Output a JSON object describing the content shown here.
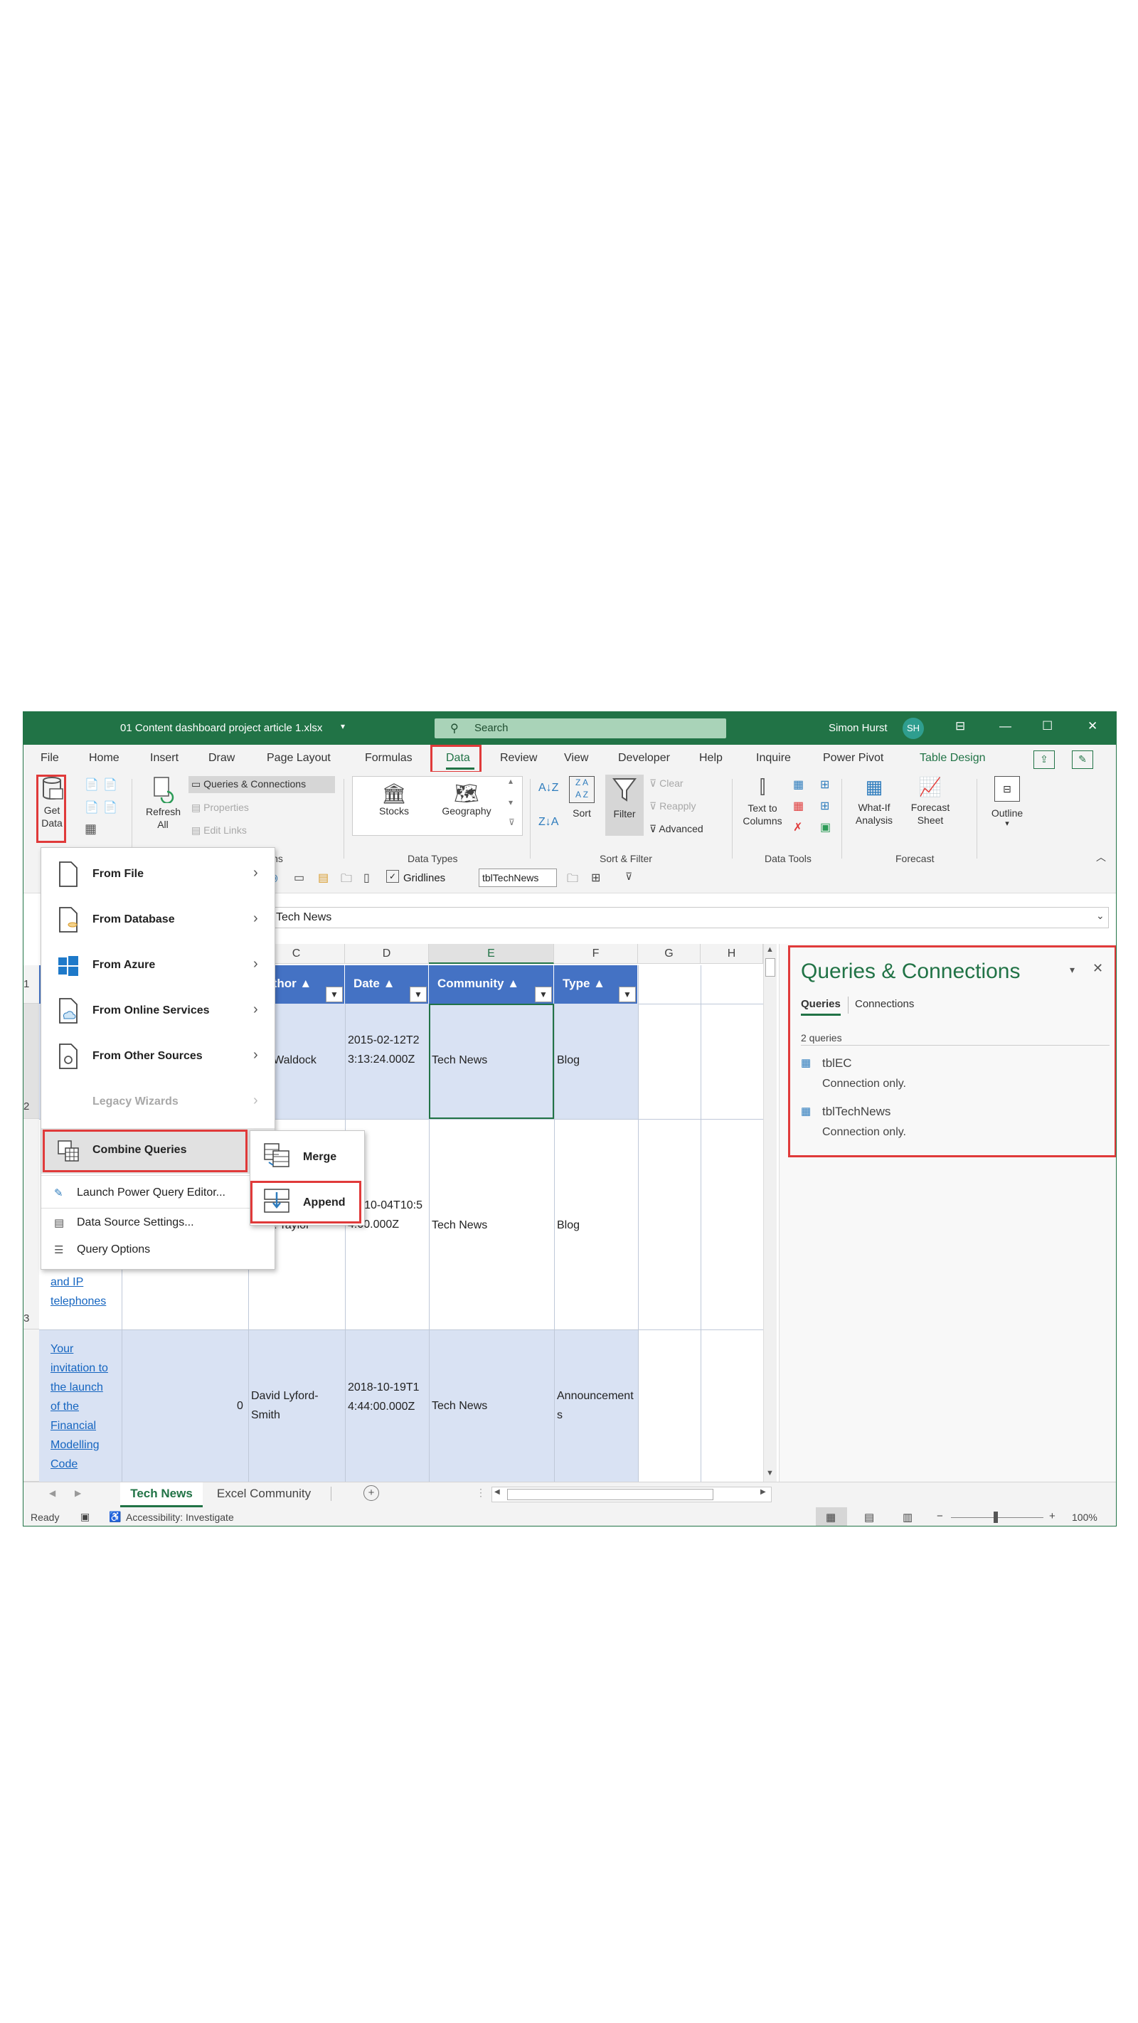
{
  "title_bar": {
    "file_name": "01 Content dashboard project article 1.xlsx",
    "search_placeholder": "Search",
    "user_name": "Simon Hurst",
    "user_initials": "SH"
  },
  "menu_tabs": [
    "File",
    "Home",
    "Insert",
    "Draw",
    "Page Layout",
    "Formulas",
    "Data",
    "Review",
    "View",
    "Developer",
    "Help",
    "Inquire",
    "Power Pivot",
    "Table Design"
  ],
  "ribbon": {
    "get_data": "Get Data",
    "refresh_all": "Refresh All",
    "queries_connections": "Queries & Connections",
    "properties": "Properties",
    "edit_links": "Edit Links",
    "stocks": "Stocks",
    "geography": "Geography",
    "sort": "Sort",
    "filter": "Filter",
    "clear": "Clear",
    "reapply": "Reapply",
    "advanced": "Advanced",
    "text_to_columns": "Text to Columns",
    "what_if": "What-If Analysis",
    "forecast_sheet": "Forecast Sheet",
    "outline": "Outline",
    "group_connections": "nnections",
    "group_data_types": "Data Types",
    "group_sort_filter": "Sort & Filter",
    "group_data_tools": "Data Tools",
    "group_forecast": "Forecast"
  },
  "quick_bar": {
    "gridlines": "Gridlines",
    "table_name": "tblTechNews"
  },
  "formula_bar": {
    "value": "Tech News"
  },
  "grid": {
    "col_letters": [
      "C",
      "D",
      "E",
      "F",
      "G",
      "H"
    ],
    "row_numbers": [
      "1",
      "2",
      "3"
    ],
    "headers": [
      "Author ▲",
      "Date ▲",
      "Community ▲",
      "Type ▲"
    ],
    "rows": [
      {
        "author": "Leo Waldock",
        "date": "2015-02-12T23:13:24.000Z",
        "community": "Tech News",
        "type": "Blog"
      },
      {
        "author": "Mark Taylor",
        "date": "19-10-04T10:54:00.000Z",
        "community": "Tech News",
        "type": "Blog",
        "title_lines": [
          "and IP",
          "telephones"
        ]
      },
      {
        "author": "David Lyford-Smith",
        "date": "2018-10-19T14:44:00.000Z",
        "community": "Tech News",
        "type": "Announcements",
        "num": "0",
        "title_lines": [
          "Your",
          "invitation to",
          "the launch",
          "of the",
          "Financial",
          "Modelling",
          "Code"
        ]
      }
    ]
  },
  "queries_pane": {
    "title": "Queries & Connections",
    "tab_queries": "Queries",
    "tab_connections": "Connections",
    "count": "2 queries",
    "items": [
      {
        "name": "tblEC",
        "status": "Connection only."
      },
      {
        "name": "tblTechNews",
        "status": "Connection only."
      }
    ]
  },
  "get_data_menu": {
    "items": [
      "From File",
      "From Database",
      "From Azure",
      "From Online Services",
      "From Other Sources",
      "Legacy Wizards",
      "Combine Queries"
    ],
    "small_items": [
      "Launch Power Query Editor...",
      "Data Source Settings...",
      "Query Options"
    ]
  },
  "combine_submenu": {
    "merge": "Merge",
    "append": "Append"
  },
  "sheet_tabs": [
    "Tech News",
    "Excel Community"
  ],
  "status_bar": {
    "ready": "Ready",
    "accessibility": "Accessibility: Investigate",
    "zoom": "100%"
  },
  "colors": {
    "excel_green": "#217346",
    "table_header": "#4472c4",
    "band": "#d9e2f3",
    "highlight_red": "#e03a3a"
  }
}
